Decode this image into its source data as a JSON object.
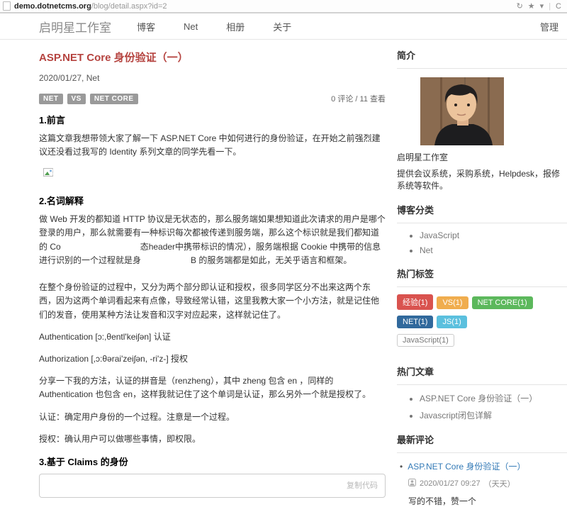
{
  "browser": {
    "url_host": "demo.dotnetcms.org",
    "url_path": "/blog/detail.aspx?id=2",
    "icons": {
      "refresh": "↻",
      "star": "★",
      "caret": "▾",
      "sep": "|",
      "extra": "C"
    }
  },
  "nav": {
    "brand": "启明星工作室",
    "items": [
      "博客",
      "Net",
      "相册",
      "关于"
    ],
    "admin": "管理"
  },
  "article": {
    "title": "ASP.NET Core 身份验证（一）",
    "meta": "2020/01/27, Net",
    "tags": [
      "NET",
      "VS",
      "NET CORE"
    ],
    "stats": "0 评论 / 11 查看",
    "h1": "1.前言",
    "p1": "这篇文章我想带领大家了解一下 ASP.NET Core 中如何进行的身份验证，在开始之前强烈建议还没看过我写的 Identity 系列文章的同学先看一下。",
    "h2": "2.名词解释",
    "p2_seg1": "做 Web 开发的都知道 HTTP 协议是无状态的，那么服务端如果想知道此次请求的用户是哪个登录的用户，那么就需要有一种标识每次都被传递到服务端，那么这个标识就是我们都知道的 Co",
    "p2_seg2": "态header中携带标识的情况），服务端根据 Cookie 中携带的信息进行识别的一个过程就是身",
    "p2_seg3": "B 的服务端都是如此，无关乎语言和框架。",
    "p3": "在整个身份验证的过程中，又分为两个部分即认证和授权，很多同学区分不出来这两个东西，因为这两个单词看起来有点像，导致经常认错，这里我教大家一个小方法，就是记住他们的发音，使用某种方法让发音和汉字对应起来，这样就记住了。",
    "p4": "Authentication [ɔ:,θentl'keiʃən] 认证",
    "p5": "Authorization [,ɔ:θərai'zeiʃən, -ri'z-] 授权",
    "p6": "分享一下我的方法，认证的拼音是（renzheng），其中 zheng 包含 en ，同样的 Authentication 也包含 en，这样我就记住了这个单词是认证，那么另外一个就是授权了。",
    "p7": "认证：确定用户身份的一个过程。注意是一个过程。",
    "p8": "授权：确认用户可以做哪些事情，即权限。",
    "h3": "3.基于 Claims 的身份",
    "code_copy": "复制代码"
  },
  "sidebar": {
    "intro_title": "简介",
    "intro_name": "启明星工作室",
    "intro_desc": "提供会议系统，采购系统，Helpdesk，报修系统等软件。",
    "categories_title": "博客分类",
    "categories": [
      "JavaScript",
      "Net"
    ],
    "tags_title": "热门标签",
    "tags": [
      {
        "label": "经验(1)",
        "color": "#d9534f"
      },
      {
        "label": "VS(1)",
        "color": "#f0ad4e"
      },
      {
        "label": "NET CORE(1)",
        "color": "#5cb85c"
      },
      {
        "label": "NET(1)",
        "color": "#31699c"
      },
      {
        "label": "JS(1)",
        "color": "#5bc0de"
      },
      {
        "label": "JavaScript(1)",
        "color": ""
      }
    ],
    "hot_title": "热门文章",
    "hot_posts": [
      "ASP.NET Core 身份验证（一）",
      "Javascript闭包详解"
    ],
    "comments_title": "最新评论",
    "comment": {
      "post": "ASP.NET Core 身份验证（一）",
      "meta": "2020/01/27 09:27",
      "author": "（天天）",
      "text": "写的不错，赞一个"
    }
  }
}
